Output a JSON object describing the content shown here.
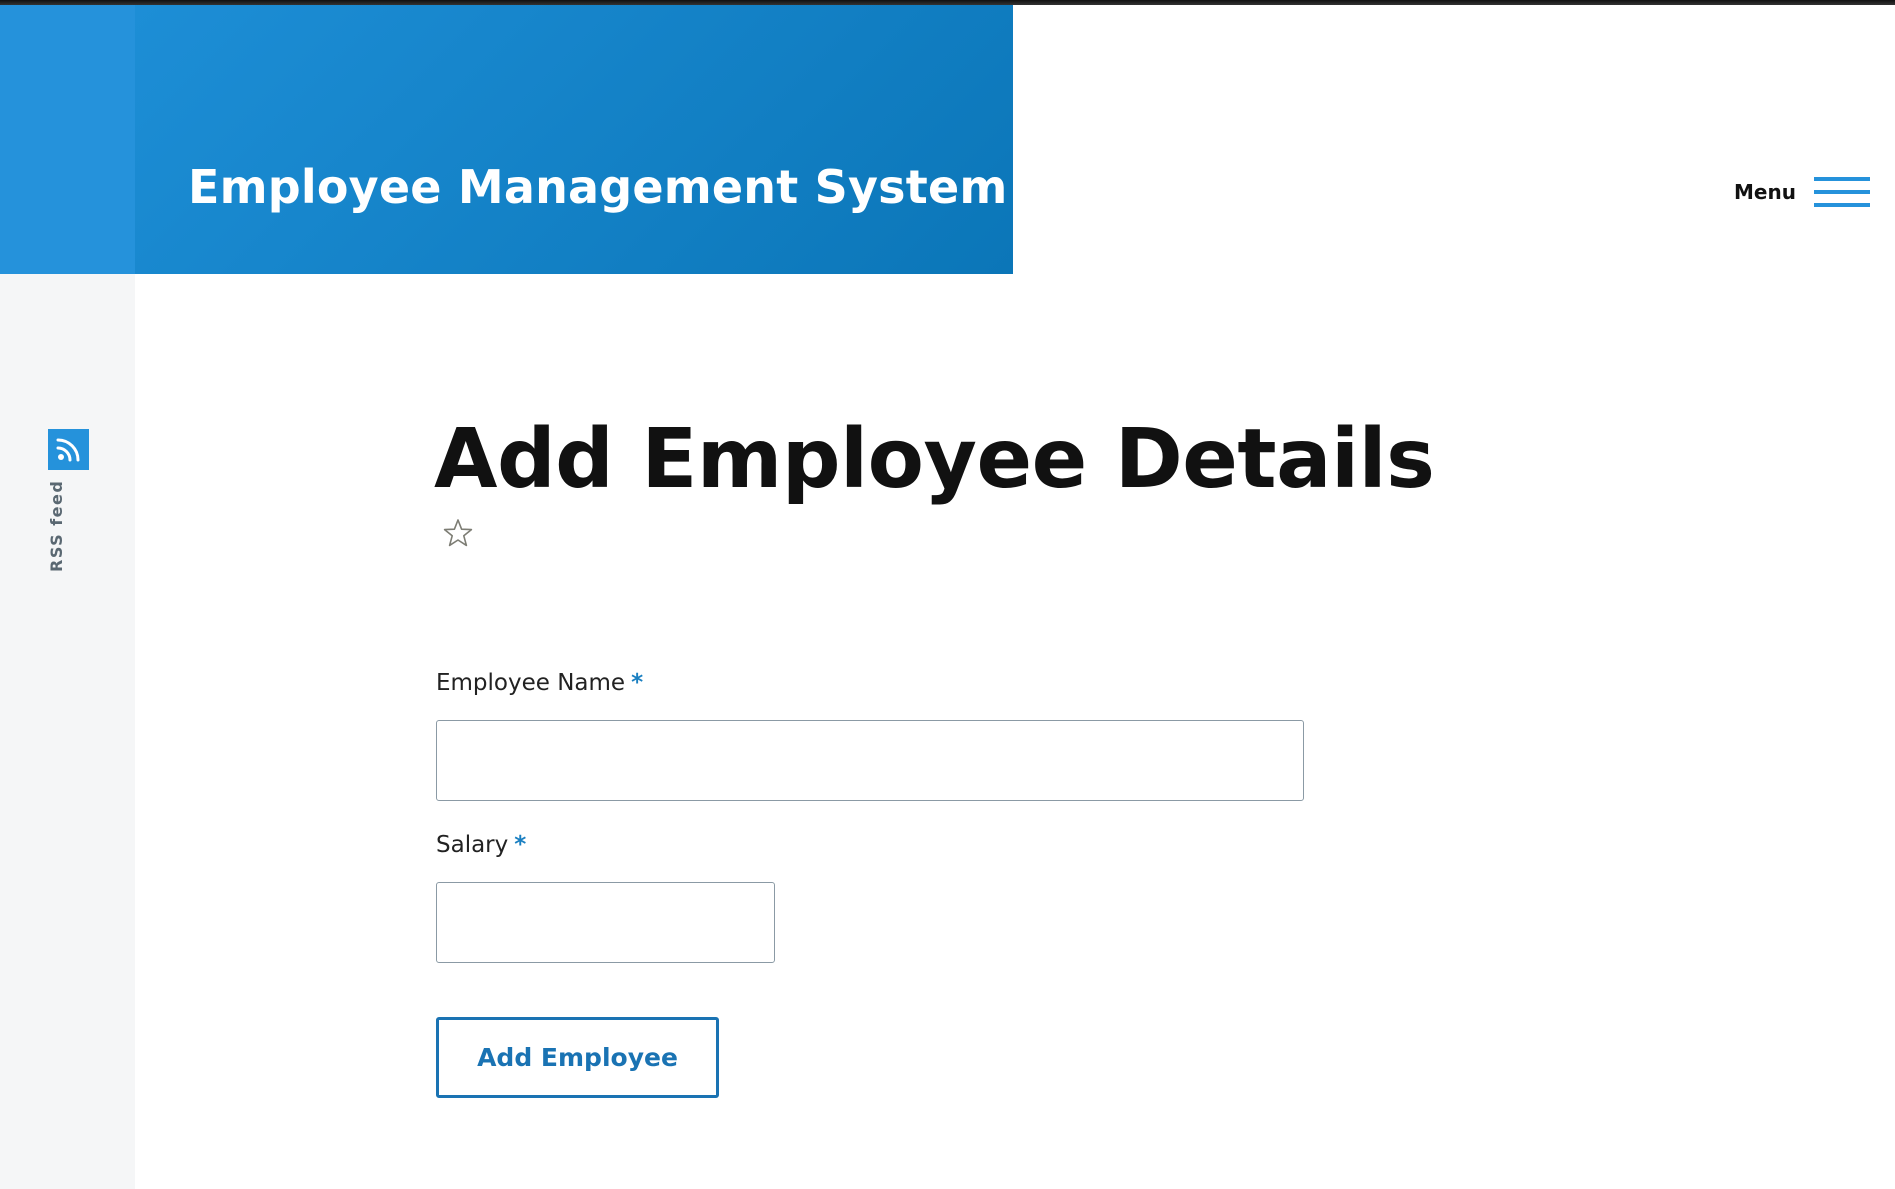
{
  "header": {
    "site_title": "Employee Management System",
    "menu_label": "Menu"
  },
  "sidebar": {
    "rss_label": "RSS feed"
  },
  "main": {
    "page_title": "Add Employee Details",
    "form": {
      "employee_name": {
        "label": "Employee Name",
        "required_mark": "*",
        "value": ""
      },
      "salary": {
        "label": "Salary",
        "required_mark": "*",
        "value": ""
      },
      "submit_label": "Add Employee"
    }
  },
  "colors": {
    "brand_blue": "#2592db",
    "header_blue_dark": "#0b76b8",
    "button_blue": "#1a73b3",
    "required_blue": "#1a7fc1"
  },
  "icons": {
    "rss": "rss-icon",
    "menu": "hamburger-icon",
    "bookmark": "star-outline-icon"
  }
}
